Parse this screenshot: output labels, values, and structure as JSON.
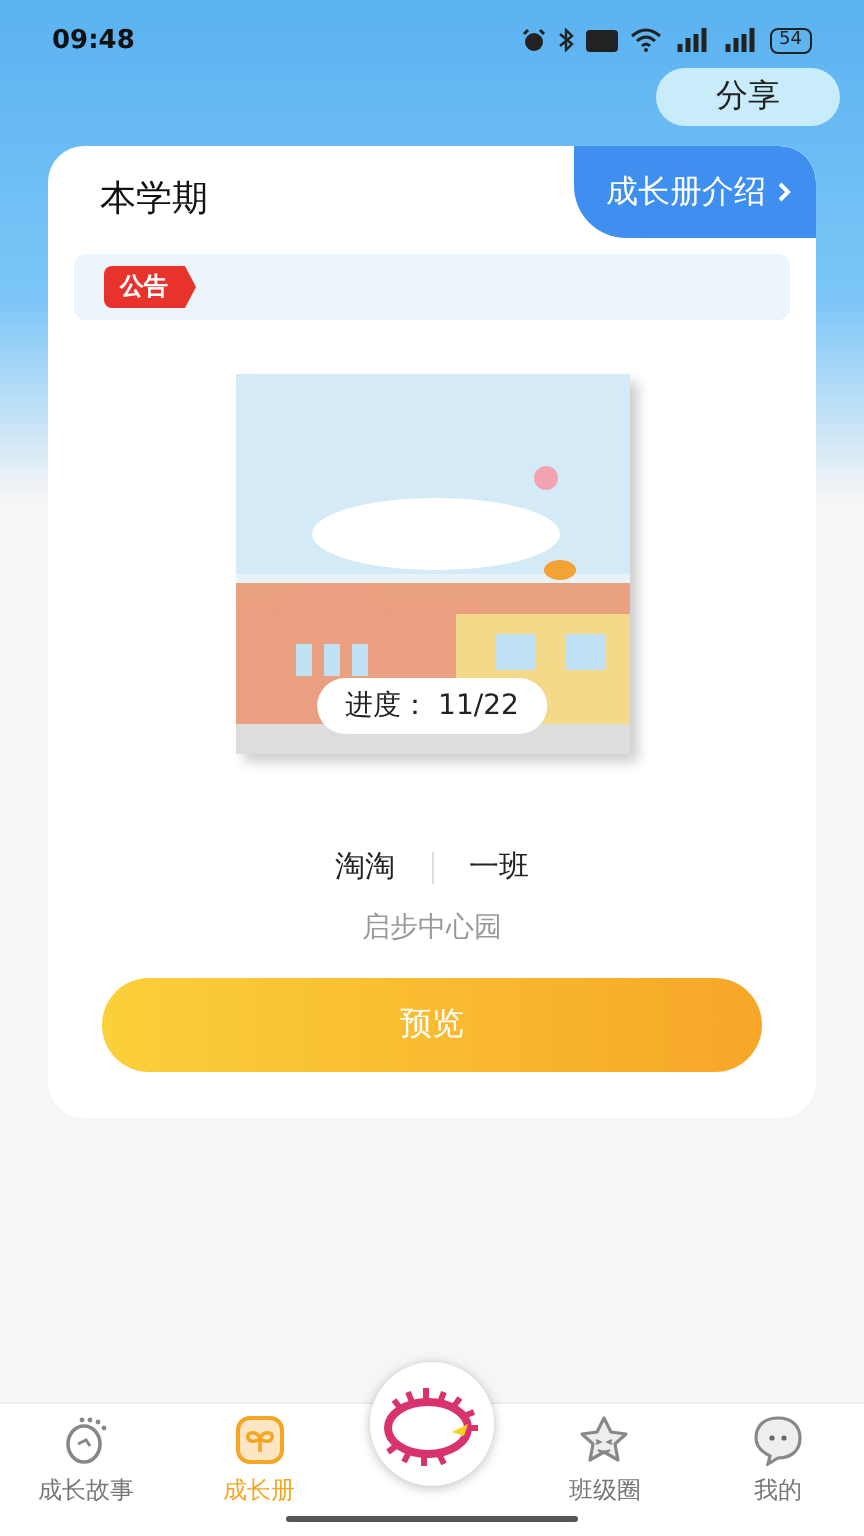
{
  "status_bar": {
    "time": "09:48",
    "battery": "54"
  },
  "share_button": {
    "label": "分享"
  },
  "card": {
    "title": "本学期",
    "intro_link": "成长册介绍",
    "notice_badge": "公告",
    "book": {
      "progress_label": "进度：",
      "progress_value": "11/22"
    },
    "child_name": "淘淘",
    "class_name": "一班",
    "school": "启步中心园",
    "preview_button": {
      "label": "预览"
    }
  },
  "tab_bar": [
    {
      "kind": "tab",
      "label": "成长故事",
      "selected": false
    },
    {
      "kind": "tab",
      "label": "成长册",
      "selected": true
    },
    {
      "kind": "logo"
    },
    {
      "kind": "tab",
      "label": "班级圈",
      "selected": false
    },
    {
      "kind": "tab",
      "label": "我的",
      "selected": false
    }
  ]
}
